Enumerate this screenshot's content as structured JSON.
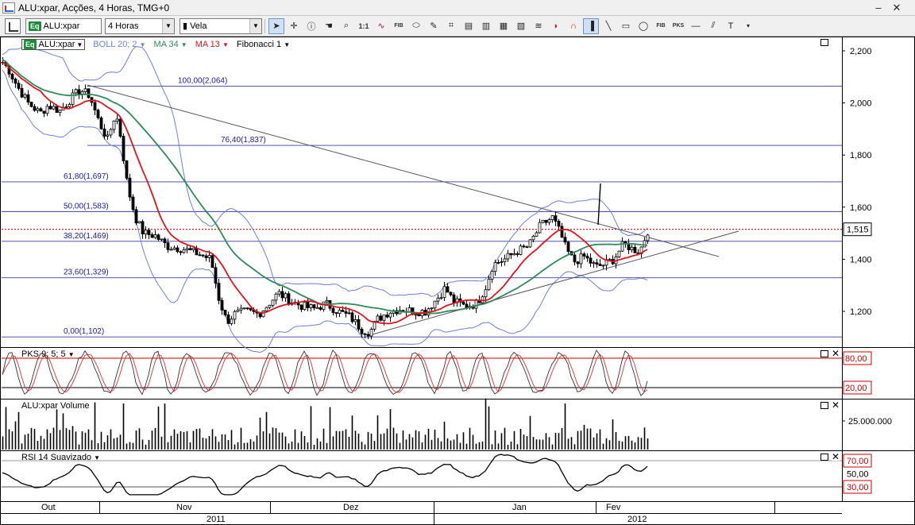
{
  "window": {
    "title": "ALU:xpar, Acções, 4 Horas, TMG+0",
    "minimize": "‒",
    "close": "✕"
  },
  "toolbar": {
    "symbol_badge": "Eq",
    "symbol": "ALU:xpar",
    "period": "4 Horas",
    "chart_type": "Vela",
    "ratio_label": "1:1",
    "fib_label": "FIB",
    "pks_label": "PKS"
  },
  "main_panel": {
    "legend": {
      "symbol_badge": "Eq",
      "symbol": "ALU:xpar",
      "boll": "BOLL 20; 2",
      "ma34": "MA 34",
      "ma13": "MA 13",
      "fibo": "Fibonacci 1"
    },
    "price_axis": [
      "2,200",
      "2,000",
      "1,800",
      "1,600",
      "1,400",
      "1,200"
    ],
    "current_price": "1,515",
    "fib_labels": [
      "100,00(2,064)",
      "76,40(1,837)",
      "61,80(1,697)",
      "50,00(1,583)",
      "38,20(1,469)",
      "23,60(1,329)",
      "0,00(1,102)"
    ]
  },
  "pks_panel": {
    "label": "PKS 9; 5; 5",
    "levels": [
      "80,00",
      "20,00"
    ]
  },
  "volume_panel": {
    "label": "ALU:xpar Volume",
    "axis": "25.000.000"
  },
  "rsi_panel": {
    "label": "RSI 14 Suavizado",
    "levels": [
      "70,00",
      "50,00",
      "30,00"
    ]
  },
  "time_axis": {
    "months": [
      "Out",
      "Nov",
      "Dez",
      "Jan",
      "Fev"
    ],
    "years": [
      "2011",
      "2012"
    ]
  },
  "colors": {
    "ma13": "#e0141e",
    "ma34": "#2e8b57",
    "bollinger": "#6d7fe0",
    "fib": "#1a1a9e",
    "current_price_line": "#d00000"
  }
}
